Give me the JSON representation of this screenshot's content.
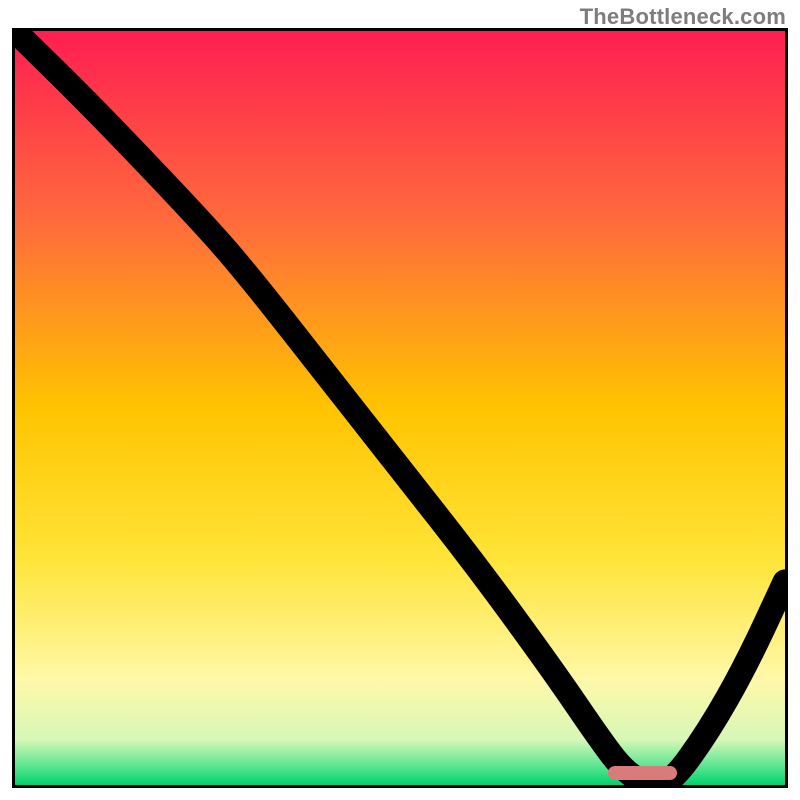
{
  "watermark": "TheBottleneck.com",
  "chart_data": {
    "type": "line",
    "title": "",
    "xlabel": "",
    "ylabel": "",
    "xlim": [
      0,
      100
    ],
    "ylim": [
      0,
      100
    ],
    "gradient_stops": [
      {
        "pct": 0,
        "color": "#ff1e52"
      },
      {
        "pct": 25,
        "color": "#ff6a3c"
      },
      {
        "pct": 50,
        "color": "#ffc400"
      },
      {
        "pct": 70,
        "color": "#ffe438"
      },
      {
        "pct": 86,
        "color": "#fff8a8"
      },
      {
        "pct": 94,
        "color": "#d7f7b8"
      },
      {
        "pct": 97.5,
        "color": "#5be591"
      },
      {
        "pct": 100,
        "color": "#00d36c"
      }
    ],
    "series": [
      {
        "name": "bottleneck-curve",
        "x": [
          0,
          10,
          24,
          30,
          40,
          50,
          60,
          70,
          76,
          79,
          82,
          85,
          90,
          95,
          100
        ],
        "y": [
          100,
          90,
          75,
          68,
          55,
          42,
          29,
          15,
          6,
          2,
          0,
          0,
          7,
          16,
          27
        ]
      }
    ],
    "marker": {
      "x_start": 77,
      "x_end": 86,
      "y": 0.6
    }
  }
}
